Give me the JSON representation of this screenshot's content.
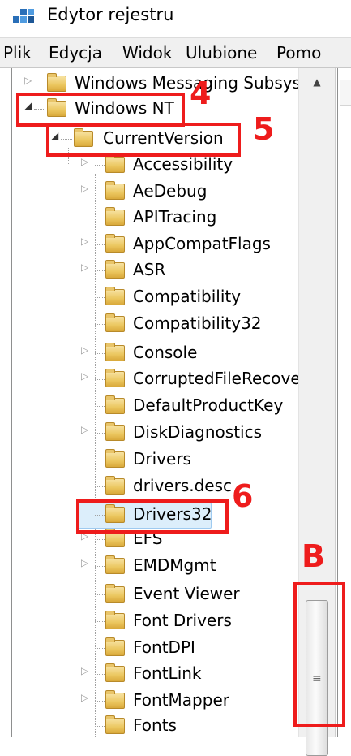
{
  "window": {
    "title": "Edytor rejestru",
    "icon": "registry-editor-icon"
  },
  "menu": {
    "items": [
      "Plik",
      "Edycja",
      "Widok",
      "Ulubione",
      "Pomo"
    ]
  },
  "tree": {
    "nodes": [
      {
        "label": "Windows Messaging Subsyste",
        "state": "collapsed"
      },
      {
        "label": "Windows NT",
        "state": "expanded"
      },
      {
        "label": "CurrentVersion",
        "state": "expanded"
      },
      {
        "label": "Accessibility",
        "state": "collapsed"
      },
      {
        "label": "AeDebug",
        "state": "collapsed"
      },
      {
        "label": "APITracing",
        "state": "leaf"
      },
      {
        "label": "AppCompatFlags",
        "state": "collapsed"
      },
      {
        "label": "ASR",
        "state": "collapsed"
      },
      {
        "label": "Compatibility",
        "state": "leaf"
      },
      {
        "label": "Compatibility32",
        "state": "leaf"
      },
      {
        "label": "Console",
        "state": "collapsed"
      },
      {
        "label": "CorruptedFileRecovery",
        "state": "collapsed"
      },
      {
        "label": "DefaultProductKey",
        "state": "leaf"
      },
      {
        "label": "DiskDiagnostics",
        "state": "collapsed"
      },
      {
        "label": "Drivers",
        "state": "leaf"
      },
      {
        "label": "drivers.desc",
        "state": "leaf"
      },
      {
        "label": "Drivers32",
        "state": "leaf",
        "selected": true
      },
      {
        "label": "EFS",
        "state": "collapsed"
      },
      {
        "label": "EMDMgmt",
        "state": "collapsed"
      },
      {
        "label": "Event Viewer",
        "state": "leaf"
      },
      {
        "label": "Font Drivers",
        "state": "leaf"
      },
      {
        "label": "FontDPI",
        "state": "leaf"
      },
      {
        "label": "FontLink",
        "state": "collapsed"
      },
      {
        "label": "FontMapper",
        "state": "collapsed"
      },
      {
        "label": "Fonts",
        "state": "leaf"
      }
    ]
  },
  "annotations": {
    "step4": "4",
    "step5": "5",
    "step6": "6",
    "stepB": "B"
  },
  "colors": {
    "annotation": "#ee1c1c",
    "selection": "#dceefb"
  }
}
